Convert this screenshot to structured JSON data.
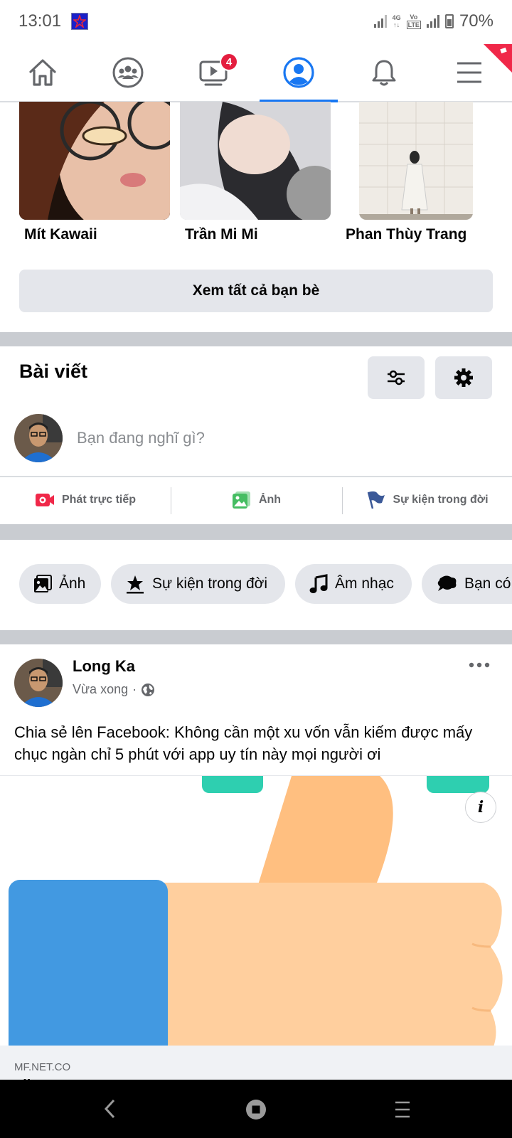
{
  "status_bar": {
    "time": "13:01",
    "network_label": "4G",
    "volte_label": "Vo LTE",
    "battery": "70%"
  },
  "nav": {
    "tabs": [
      {
        "name": "home",
        "icon": "home-icon"
      },
      {
        "name": "groups",
        "icon": "groups-icon"
      },
      {
        "name": "watch",
        "icon": "video-play-icon",
        "badge": "4"
      },
      {
        "name": "profile",
        "icon": "profile-icon",
        "active": true
      },
      {
        "name": "notifications",
        "icon": "bell-icon"
      },
      {
        "name": "menu",
        "icon": "hamburger-menu-icon"
      }
    ],
    "watch_badge": "4"
  },
  "friends": {
    "items": [
      {
        "name": "Mít Kawaii"
      },
      {
        "name": "Trần Mi Mi"
      },
      {
        "name": "Phan Thùy Trang"
      }
    ],
    "see_all_label": "Xem tất cả bạn bè"
  },
  "posts_section": {
    "title": "Bài viết",
    "composer_placeholder": "Bạn đang nghĩ gì?",
    "actions": [
      {
        "label": "Phát trực tiếp",
        "icon": "live-video-icon",
        "color": "#f02849"
      },
      {
        "label": "Ảnh",
        "icon": "photo-icon",
        "color": "#45bd62"
      },
      {
        "label": "Sự kiện trong đời",
        "icon": "flag-icon",
        "color": "#3b5998"
      }
    ]
  },
  "chips": [
    {
      "label": "Ảnh",
      "icon": "photo-icon"
    },
    {
      "label": "Sự kiện trong đời",
      "icon": "life-event-icon"
    },
    {
      "label": "Âm nhạc",
      "icon": "music-note-icon"
    },
    {
      "label": "Bạn có",
      "icon": "speech-bubble-icon"
    }
  ],
  "post": {
    "author": "Long Ka",
    "time": "Vừa xong",
    "privacy_icon": "globe-icon",
    "text": "Chia sẻ lên Facebook: Không cần một xu vốn vẫn kiếm được mấy chục ngàn chỉ 5 phút với app uy tín này mọi người ơi",
    "link_domain": "MF.NET.CO",
    "link_title_peek": "Lik"
  },
  "colors": {
    "accent": "#1877f2",
    "badge": "#e41e3f",
    "thumb_skin": "#ffcf9e",
    "cuff": "#4299e1",
    "teal": "#2ecfb0"
  }
}
